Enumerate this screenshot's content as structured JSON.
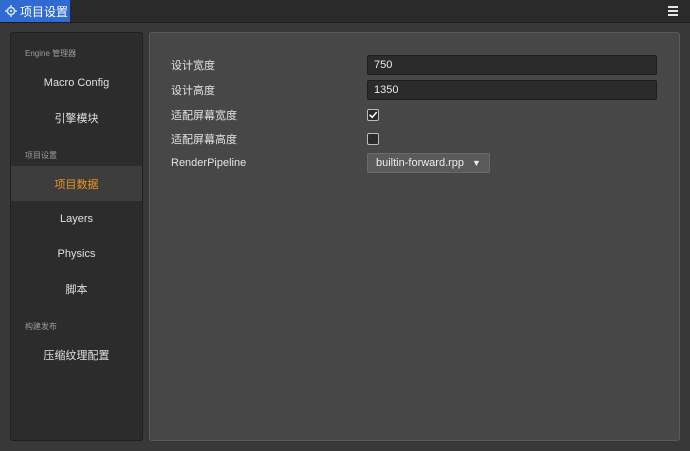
{
  "window": {
    "tab_title": "项目设置",
    "tab_icon": "gear-icon",
    "menu_icon": "hamburger-menu-icon",
    "accent_color": "#2f6bd1"
  },
  "sidebar": {
    "sections": [
      {
        "title": "Engine 管理器",
        "items": [
          {
            "label": "Macro Config",
            "active": false
          },
          {
            "label": "引擎模块",
            "active": false
          }
        ]
      },
      {
        "title": "项目设置",
        "items": [
          {
            "label": "项目数据",
            "active": true
          },
          {
            "label": "Layers",
            "active": false
          },
          {
            "label": "Physics",
            "active": false
          },
          {
            "label": "脚本",
            "active": false
          }
        ]
      },
      {
        "title": "构建发布",
        "items": [
          {
            "label": "压缩纹理配置",
            "active": false
          }
        ]
      }
    ],
    "active_color": "#e8951e"
  },
  "settings": {
    "design_width": {
      "label": "设计宽度",
      "value": "750"
    },
    "design_height": {
      "label": "设计高度",
      "value": "1350"
    },
    "fit_width": {
      "label": "适配屏幕宽度",
      "checked": true
    },
    "fit_height": {
      "label": "适配屏幕高度",
      "checked": false
    },
    "render_pipeline": {
      "label": "RenderPipeline",
      "value": "builtin-forward.rpp"
    }
  }
}
